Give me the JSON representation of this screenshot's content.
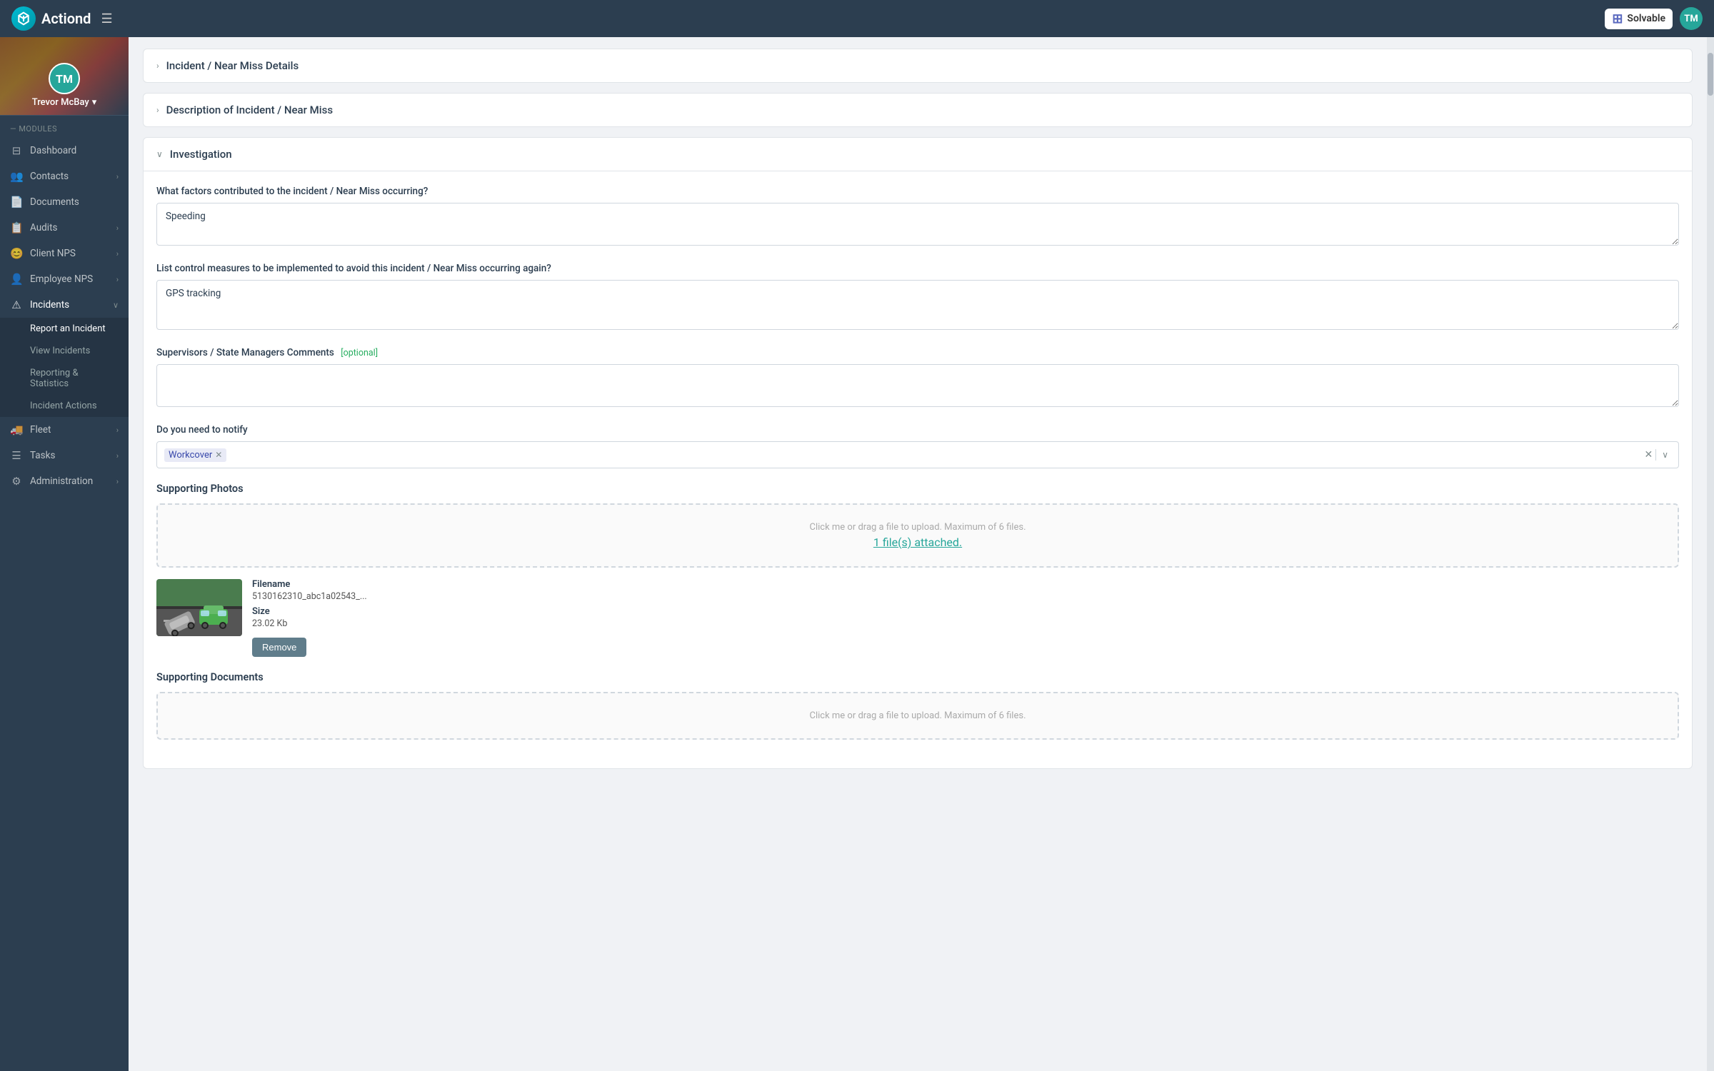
{
  "app": {
    "name": "Actiond",
    "menu_icon": "☰"
  },
  "topnav": {
    "brand": "Solvable",
    "brand_icon": "⊞",
    "user_initials": "TM"
  },
  "sidebar": {
    "user": {
      "name": "Trevor McBay",
      "initials": "TM"
    },
    "modules_label": "— MODULES",
    "items": [
      {
        "id": "dashboard",
        "label": "Dashboard",
        "icon": "⊟",
        "has_children": false
      },
      {
        "id": "contacts",
        "label": "Contacts",
        "icon": "👥",
        "has_children": true
      },
      {
        "id": "documents",
        "label": "Documents",
        "icon": "📄",
        "has_children": false
      },
      {
        "id": "audits",
        "label": "Audits",
        "icon": "📋",
        "has_children": true
      },
      {
        "id": "client-nps",
        "label": "Client NPS",
        "icon": "😊",
        "has_children": true
      },
      {
        "id": "employee-nps",
        "label": "Employee NPS",
        "icon": "👤",
        "has_children": true
      },
      {
        "id": "incidents",
        "label": "Incidents",
        "icon": "⚠",
        "has_children": true,
        "active": true
      },
      {
        "id": "fleet",
        "label": "Fleet",
        "icon": "🚚",
        "has_children": true
      },
      {
        "id": "tasks",
        "label": "Tasks",
        "icon": "☰",
        "has_children": true
      },
      {
        "id": "administration",
        "label": "Administration",
        "icon": "⚙",
        "has_children": true
      }
    ],
    "incidents_subitems": [
      {
        "id": "report-incident",
        "label": "Report an Incident",
        "active": true
      },
      {
        "id": "view-incidents",
        "label": "View Incidents",
        "active": false
      },
      {
        "id": "reporting-statistics",
        "label": "Reporting & Statistics",
        "active": false
      },
      {
        "id": "incident-actions",
        "label": "Incident Actions",
        "active": false
      }
    ]
  },
  "sections": {
    "incident_details": {
      "title": "Incident / Near Miss Details",
      "collapsed": true
    },
    "description": {
      "title": "Description of Incident / Near Miss",
      "collapsed": true
    },
    "investigation": {
      "title": "Investigation",
      "collapsed": false,
      "fields": {
        "factors_label": "What factors contributed to the incident / Near Miss occurring?",
        "factors_value": "Speeding",
        "control_measures_label": "List control measures to be implemented to avoid this incident / Near Miss occurring again?",
        "control_measures_value": "GPS tracking",
        "supervisors_label": "Supervisors / State Managers Comments",
        "supervisors_optional": "[optional]",
        "supervisors_value": "",
        "notify_label": "Do you need to notify",
        "notify_tag": "Workcover",
        "supporting_photos_label": "Supporting Photos",
        "upload_text": "Click me or drag a file to upload. Maximum of 6 files.",
        "upload_attached": "1 file(s) attached.",
        "file_filename_label": "Filename",
        "file_filename_value": "5130162310_abc1a02543_...",
        "file_size_label": "Size",
        "file_size_value": "23.02 Kb",
        "remove_btn": "Remove",
        "supporting_docs_label": "Supporting Documents",
        "upload_text2": "Click me or drag a file to upload. Maximum of 6 files."
      }
    }
  }
}
